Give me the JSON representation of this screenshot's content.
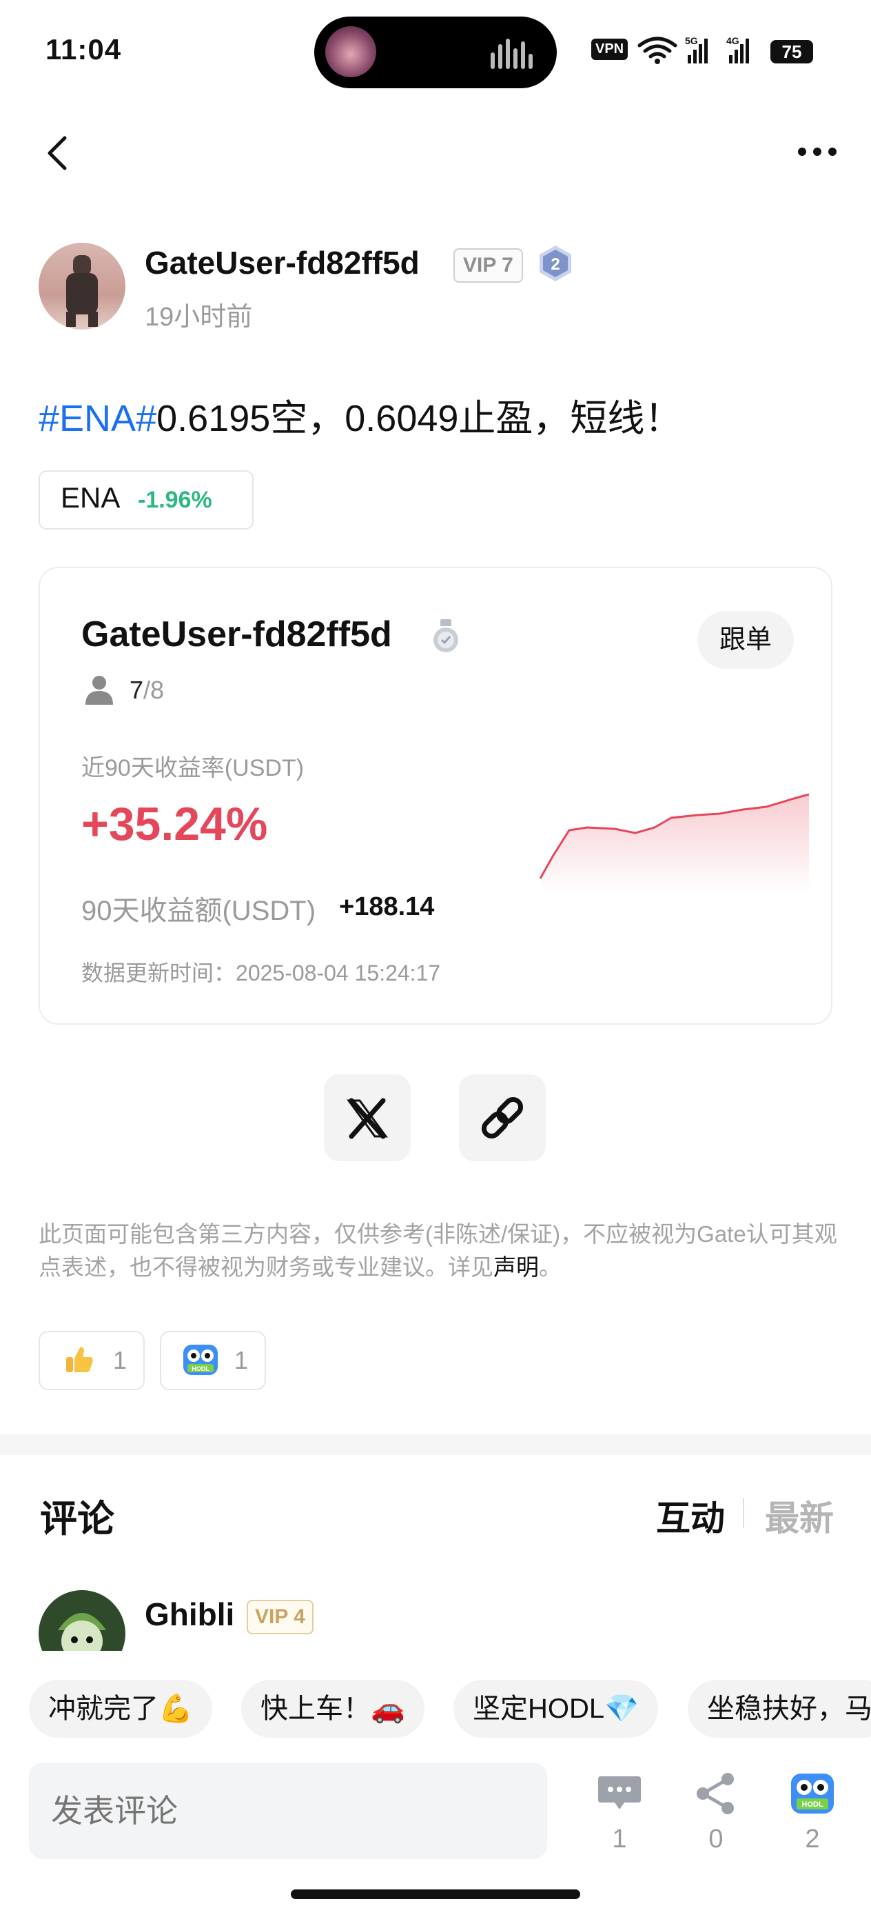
{
  "status_bar": {
    "time": "11:04",
    "vpn": "VPN",
    "net1": "5G",
    "net2": "4G",
    "battery": "75"
  },
  "nav": {
    "back_icon": "chevron-left-icon",
    "more_icon": "more-dots-icon"
  },
  "author": {
    "name": "GateUser-fd82ff5d",
    "vip": "VIP 7",
    "level": "2",
    "time": "19小时前"
  },
  "post": {
    "hashtag": "#ENA#",
    "text": "0.6195空，0.6049止盈，短线！"
  },
  "ticker": {
    "symbol": "ENA",
    "change": "-1.96%",
    "change_color": "#2db880"
  },
  "trader_card": {
    "name": "GateUser-fd82ff5d",
    "follow_label": "跟单",
    "followers_current": "7",
    "followers_max": "/8",
    "roi_label": "近90天收益率(USDT)",
    "roi_value": "+35.24%",
    "roi_color": "#e5475a",
    "pnl_label": "90天收益额(USDT)",
    "pnl_value": "+188.14",
    "update_label": "数据更新时间：",
    "update_time": "2025-08-04 15:24:17"
  },
  "share": {
    "x_icon": "x-logo-icon",
    "link_icon": "link-icon"
  },
  "disclaimer": {
    "text": "此页面可能包含第三方内容，仅供参考(非陈述/保证)，不应被视为Gate认可其观点表述，也不得被视为财务或专业建议。详见",
    "link": "声明",
    "end": "。"
  },
  "reactions": [
    {
      "icon": "thumbs-up-icon",
      "count": "1"
    },
    {
      "icon": "hodl-icon",
      "count": "1"
    }
  ],
  "comments": {
    "title": "评论",
    "tab_interact": "互动",
    "tab_latest": "最新",
    "first": {
      "name": "Ghibli",
      "vip": "VIP 4"
    }
  },
  "quick_replies": [
    "冲就完了💪",
    "快上车！🚗",
    "坚定HODL💎",
    "坐稳扶好，马"
  ],
  "bottom_bar": {
    "placeholder": "发表评论",
    "comment_count": "1",
    "share_count": "0",
    "hodl_count": "2"
  }
}
